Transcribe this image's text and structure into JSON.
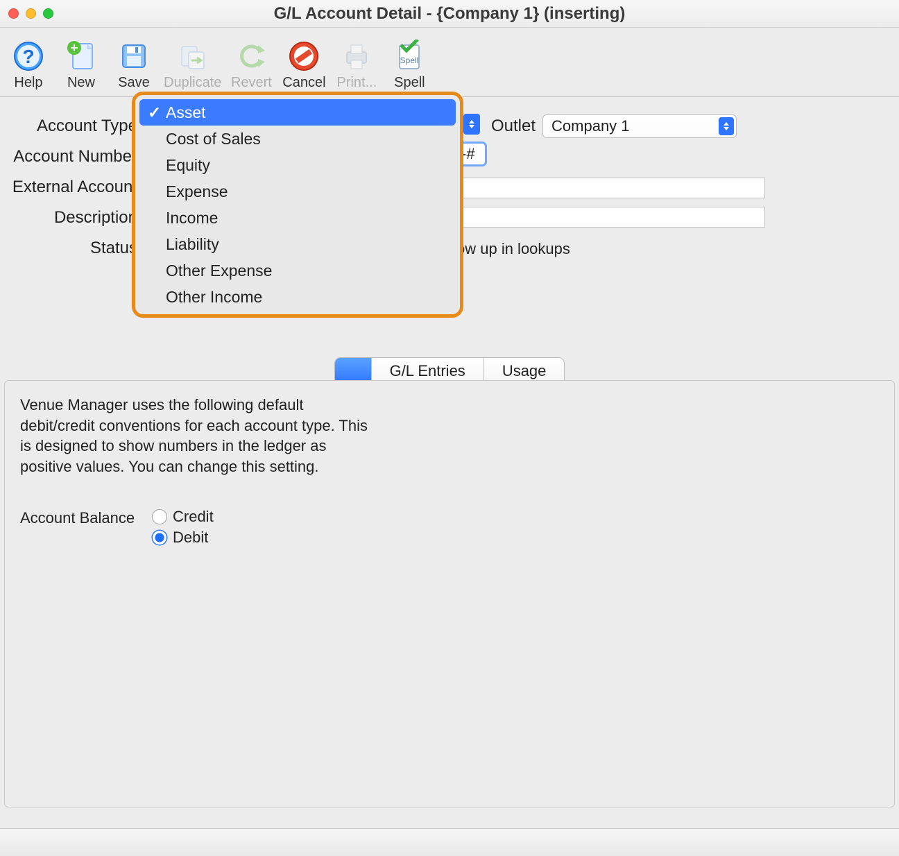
{
  "window": {
    "title": "G/L Account Detail -  {Company 1} (inserting)"
  },
  "toolbar": {
    "help": {
      "label": "Help"
    },
    "new": {
      "label": "New"
    },
    "save": {
      "label": "Save"
    },
    "duplicate": {
      "label": "Duplicate"
    },
    "revert": {
      "label": "Revert"
    },
    "cancel": {
      "label": "Cancel"
    },
    "print": {
      "label": "Print..."
    },
    "spell": {
      "label": "Spell"
    }
  },
  "form": {
    "account_type_label": "Account Type",
    "account_number_label": "Account Number",
    "external_account_label": "External Account",
    "description_label": "Description",
    "status_label": "Status",
    "outlet_label": "Outlet",
    "outlet_value": "Company 1",
    "account_number_value": "-#",
    "external_account_value": "",
    "description_value": "",
    "status_text": "ow up in lookups"
  },
  "dropdown": {
    "items": [
      "Asset",
      "Cost of Sales",
      "Equity",
      "Expense",
      "Income",
      "Liability",
      "Other Expense",
      "Other Income"
    ],
    "selected_index": 0
  },
  "tabs": [
    {
      "label_hidden_by_dropdown": true
    },
    {
      "label": "G/L Entries"
    },
    {
      "label": "Usage"
    }
  ],
  "panel": {
    "info_text": "Venue Manager uses the following default debit/credit conventions for each account type. This is designed to show numbers in the ledger as positive values.  You can change this setting.",
    "balance_label": "Account Balance",
    "balance_options": {
      "credit": "Credit",
      "debit": "Debit"
    },
    "balance_selected": "debit"
  }
}
